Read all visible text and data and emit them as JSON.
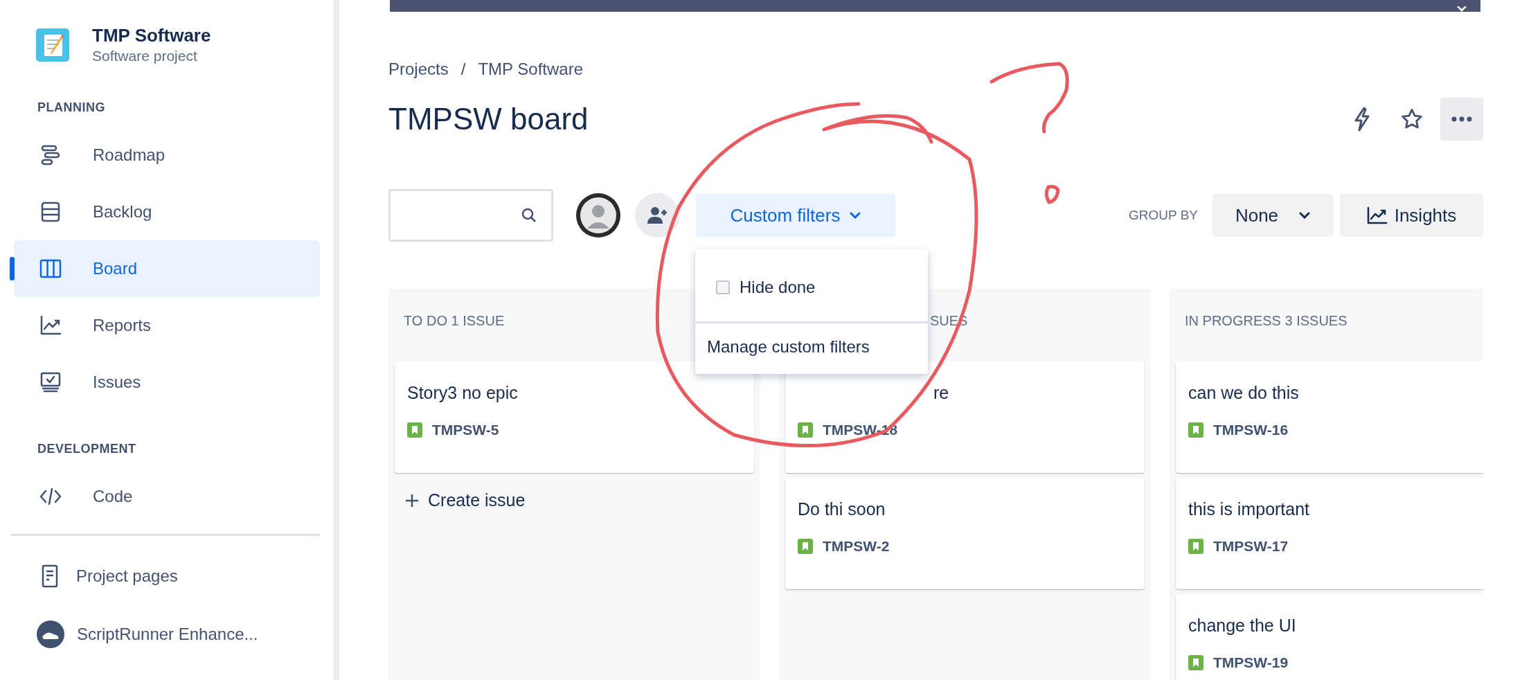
{
  "sidebar": {
    "project": {
      "name": "TMP Software",
      "type": "Software project"
    },
    "sections": [
      {
        "heading": "PLANNING",
        "items": [
          {
            "label": "Roadmap",
            "selected": false
          },
          {
            "label": "Backlog",
            "selected": false
          },
          {
            "label": "Board",
            "selected": true
          },
          {
            "label": "Reports",
            "selected": false
          },
          {
            "label": "Issues",
            "selected": false
          }
        ]
      },
      {
        "heading": "DEVELOPMENT",
        "items": [
          {
            "label": "Code",
            "selected": false
          }
        ]
      }
    ],
    "footer_items": [
      {
        "label": "Project pages"
      },
      {
        "label": "ScriptRunner Enhance..."
      }
    ]
  },
  "breadcrumbs": {
    "items": [
      "Projects",
      "TMP Software"
    ],
    "separator": "/"
  },
  "board": {
    "title": "TMPSW board"
  },
  "toolbar": {
    "custom_filters": "Custom filters",
    "group_by_label": "GROUP BY",
    "group_by_value": "None",
    "insights": "Insights"
  },
  "filters_menu": {
    "items": [
      {
        "kind": "checkbox",
        "label": "Hide done",
        "checked": false
      },
      {
        "kind": "link",
        "label": "Manage custom filters"
      }
    ]
  },
  "columns": [
    {
      "header": "TO DO 1 ISSUE",
      "cards": [
        {
          "title": "Story3 no epic",
          "key": "TMPSW-5"
        }
      ],
      "create_label": "Create issue"
    },
    {
      "header": "SUES",
      "cards": [
        {
          "title": "re",
          "key": "TMPSW-18"
        },
        {
          "title": "Do thi soon",
          "key": "TMPSW-2"
        }
      ]
    },
    {
      "header": "IN PROGRESS 3 ISSUES",
      "cards": [
        {
          "title": "can we do this",
          "key": "TMPSW-16"
        },
        {
          "title": "this is important",
          "key": "TMPSW-17"
        },
        {
          "title": "change the UI",
          "key": "TMPSW-19"
        }
      ]
    }
  ]
}
